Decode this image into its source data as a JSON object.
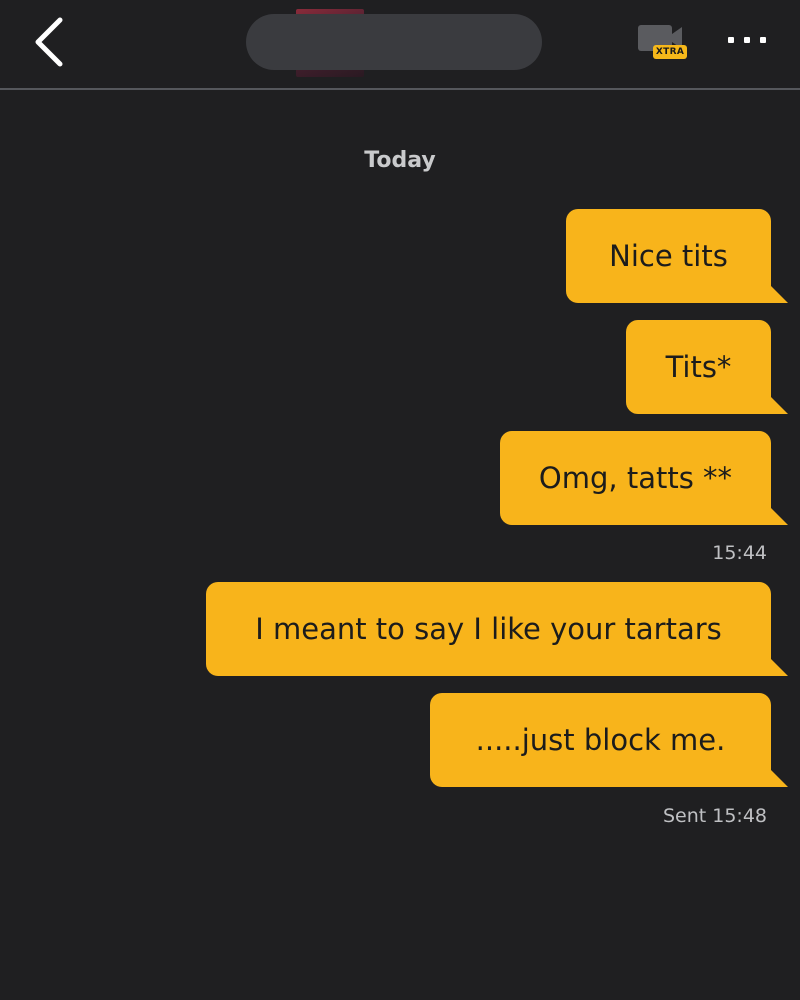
{
  "header": {
    "back_icon": "chevron-left-icon",
    "video_icon": "video-camera-icon",
    "xtra_badge": "XTRA",
    "more_icon": "more-dots-icon",
    "colors": {
      "background": "#1f1f21",
      "divider": "#55575c",
      "badge": "#f6b81a"
    }
  },
  "chat": {
    "date_label": "Today",
    "bubble_color": "#f8b41b",
    "messages": [
      {
        "text": "Nice tits"
      },
      {
        "text": "Tits*"
      },
      {
        "text": "Omg, tatts **"
      },
      {
        "text": "I meant to say I like your tartars"
      },
      {
        "text": ".....just block me."
      }
    ],
    "timestamps": {
      "first_group": "15:44",
      "last_sent": "Sent 15:48"
    }
  }
}
